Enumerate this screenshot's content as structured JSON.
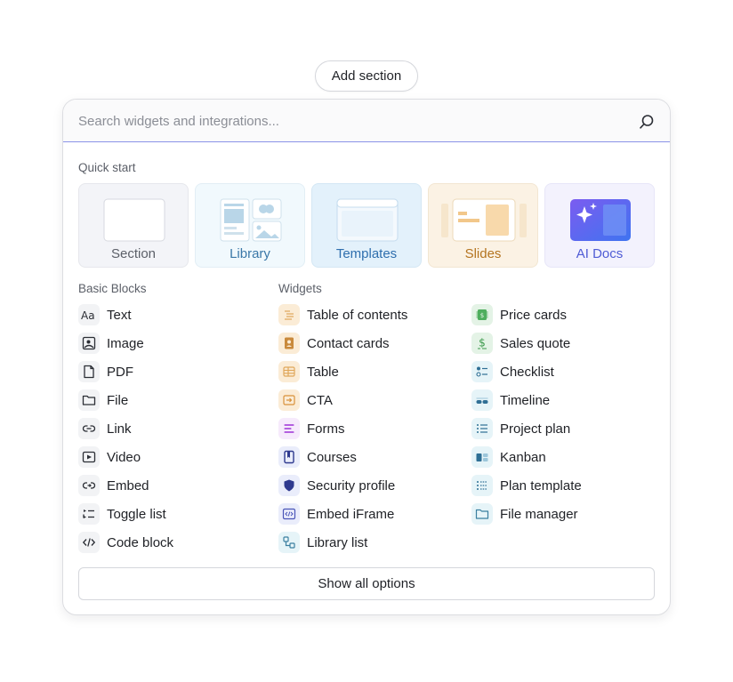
{
  "add_section_label": "Add section",
  "search": {
    "placeholder": "Search widgets and integrations..."
  },
  "quick_start": {
    "label": "Quick start",
    "cards": [
      {
        "label": "Section",
        "color": "#5b5f68",
        "bg": "#f3f4f8"
      },
      {
        "label": "Library",
        "color": "#3b78a8",
        "bg": "#f1f9fd"
      },
      {
        "label": "Templates",
        "color": "#2f6fae",
        "bg": "#e3f1fb"
      },
      {
        "label": "Slides",
        "color": "#b4741f",
        "bg": "#fbf2e4"
      },
      {
        "label": "AI Docs",
        "color": "#4f5bd5",
        "bg": "#f3f2fd"
      }
    ]
  },
  "basic_blocks": {
    "label": "Basic Blocks",
    "items": [
      {
        "label": "Text",
        "icon": "text-aa-icon"
      },
      {
        "label": "Image",
        "icon": "image-icon"
      },
      {
        "label": "PDF",
        "icon": "pdf-file-icon"
      },
      {
        "label": "File",
        "icon": "folder-icon"
      },
      {
        "label": "Link",
        "icon": "link-icon"
      },
      {
        "label": "Video",
        "icon": "video-icon"
      },
      {
        "label": "Embed",
        "icon": "embed-icon"
      },
      {
        "label": "Toggle list",
        "icon": "toggle-list-icon"
      },
      {
        "label": "Code block",
        "icon": "code-icon"
      }
    ]
  },
  "widgets": {
    "label": "Widgets",
    "col1": [
      {
        "label": "Table of contents",
        "icon": "table-of-contents-icon"
      },
      {
        "label": "Contact cards",
        "icon": "contact-card-icon"
      },
      {
        "label": "Table",
        "icon": "table-icon"
      },
      {
        "label": "CTA",
        "icon": "cta-icon"
      },
      {
        "label": "Forms",
        "icon": "forms-icon"
      },
      {
        "label": "Courses",
        "icon": "courses-icon"
      },
      {
        "label": "Security profile",
        "icon": "shield-icon"
      },
      {
        "label": "Embed iFrame",
        "icon": "iframe-icon"
      },
      {
        "label": "Library list",
        "icon": "library-list-icon"
      }
    ],
    "col2": [
      {
        "label": "Price cards",
        "icon": "price-card-icon"
      },
      {
        "label": "Sales quote",
        "icon": "dollar-icon"
      },
      {
        "label": "Checklist",
        "icon": "checklist-icon"
      },
      {
        "label": "Timeline",
        "icon": "timeline-icon"
      },
      {
        "label": "Project plan",
        "icon": "project-plan-icon"
      },
      {
        "label": "Kanban",
        "icon": "kanban-icon"
      },
      {
        "label": "Plan template",
        "icon": "plan-template-icon"
      },
      {
        "label": "File manager",
        "icon": "file-manager-icon"
      }
    ]
  },
  "show_all_label": "Show all options"
}
